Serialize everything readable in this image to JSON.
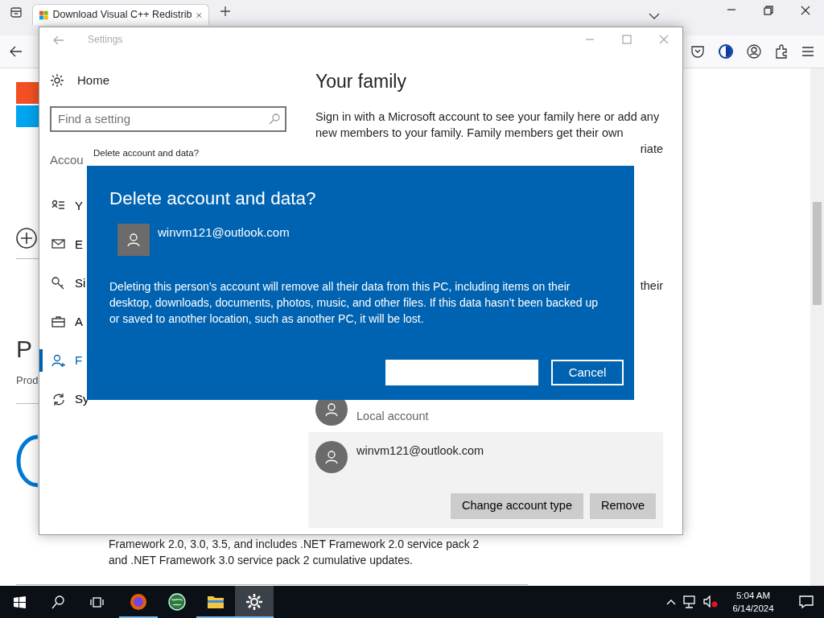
{
  "browser": {
    "tabs": [
      {
        "title": "Download Visual C++ Redistrib",
        "selected": true
      }
    ],
    "page": {
      "heading_fragment": "P",
      "label_fragment": "Prod",
      "text": [
        "Framework 2.0, 3.0, 3.5, and includes .NET Framework 2.0 service pack 2",
        "and .NET Framework 3.0 service pack 2 cumulative updates."
      ]
    }
  },
  "settings_window": {
    "title": "Settings",
    "nav": {
      "home": "Home",
      "search": {
        "placeholder": "Find a setting"
      },
      "section": "Accou",
      "items": [
        {
          "label": "Y",
          "kind": "info",
          "selected": false
        },
        {
          "label": "E",
          "kind": "mail",
          "selected": false
        },
        {
          "label": "Si",
          "kind": "key",
          "selected": false
        },
        {
          "label": "A",
          "kind": "work",
          "selected": false
        },
        {
          "label": "F",
          "kind": "family",
          "selected": true
        },
        {
          "label": "Sy",
          "kind": "sync",
          "selected": false
        }
      ]
    },
    "content": {
      "heading": "Your family",
      "intro": "Sign in with a Microsoft account to see your family here or add any new members to your family. Family members get their own",
      "fragment_1": "riate",
      "fragment_2": "their",
      "local_account": "Local account",
      "account": {
        "email": "winvm121@outlook.com",
        "buttons": [
          "Change account type",
          "Remove"
        ]
      }
    }
  },
  "dialog": {
    "caption": "Delete account and data?",
    "title": "Delete account and data?",
    "email": "winvm121@outlook.com",
    "message": "Deleting this person’s account will remove all their data from this PC, including items on their desktop, downloads, documents, photos, music, and other files. If this data hasn’t been backed up or saved to another location, such as another PC, it will be lost.",
    "buttons": [
      {
        "kind": "blank"
      },
      {
        "kind": "outline",
        "label": "Cancel"
      }
    ]
  },
  "taskbar": {
    "apps": [
      {
        "kind": "browser",
        "running": true,
        "selected": false
      },
      {
        "kind": "globe",
        "running": false,
        "selected": false
      },
      {
        "kind": "folder",
        "running": true,
        "selected": false
      },
      {
        "kind": "gear",
        "running": true,
        "selected": true
      }
    ],
    "time": "5:04 AM",
    "date": "6/14/2024"
  }
}
